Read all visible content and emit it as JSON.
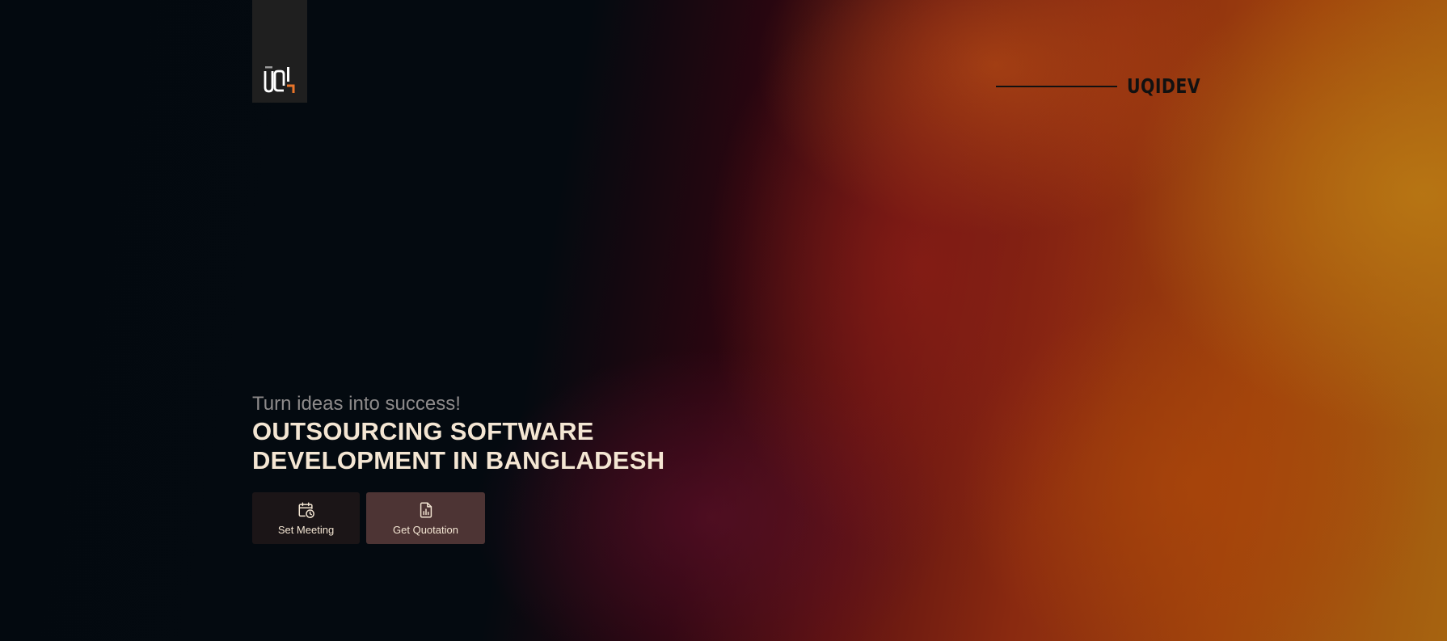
{
  "header": {
    "logo_icon": "uqi-logo-icon",
    "brand_name": "UQIDEV"
  },
  "hero": {
    "tagline": "Turn ideas into success!",
    "headline_line1": "OUTSOURCING SOFTWARE",
    "headline_line2": "DEVELOPMENT IN BANGLADESH"
  },
  "actions": {
    "set_meeting_label": "Set Meeting",
    "set_meeting_icon": "calendar-clock-icon",
    "get_quotation_label": "Get Quotation",
    "get_quotation_icon": "document-chart-icon"
  },
  "colors": {
    "headline": "#f4e6d3",
    "tagline": "#8e8b8b",
    "logo_accent": "#e8742a",
    "brand_text": "#111111"
  }
}
